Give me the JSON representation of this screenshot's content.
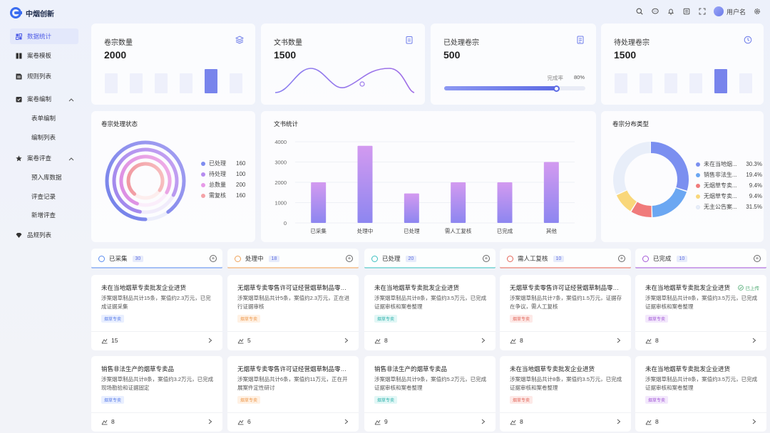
{
  "app": {
    "title": "中烟创新",
    "username": "用户名"
  },
  "topbar": {
    "icons": [
      "search-icon",
      "message-icon",
      "bell-icon",
      "document-icon",
      "fullscreen-icon",
      "user-avatar",
      "settings-icon"
    ]
  },
  "sidebar": {
    "items": [
      {
        "label": "数据统计",
        "icon": "dashboard-icon",
        "active": true
      },
      {
        "label": "案卷模板",
        "icon": "template-icon"
      },
      {
        "label": "规则列表",
        "icon": "rules-icon"
      },
      {
        "label": "案卷编制",
        "icon": "edit-icon",
        "expanded": true
      },
      {
        "label": "表单编制",
        "sub": true
      },
      {
        "label": "编制列表",
        "sub": true
      },
      {
        "label": "案卷评查",
        "icon": "star-icon",
        "expanded": true
      },
      {
        "label": "预入库数据",
        "sub": true
      },
      {
        "label": "评查记录",
        "sub": true
      },
      {
        "label": "新增评查",
        "sub": true
      },
      {
        "label": "品规列表",
        "icon": "gem-icon"
      }
    ]
  },
  "stats": [
    {
      "title": "卷宗数量",
      "value": "2000",
      "icon": "layers-icon"
    },
    {
      "title": "文书数量",
      "value": "1500",
      "icon": "clipboard-icon"
    },
    {
      "title": "已处理卷宗",
      "value": "500",
      "icon": "file-check-icon",
      "progress_label": "完成率",
      "progress_text": "80%",
      "progress": 0.8
    },
    {
      "title": "待处理卷宗",
      "value": "1500",
      "icon": "clock-icon"
    }
  ],
  "status_panel": {
    "title": "卷宗处理状态",
    "legend": [
      {
        "label": "已处理",
        "value": "160",
        "color": "#7f8cf0"
      },
      {
        "label": "待处理",
        "value": "100",
        "color": "#b68cf0"
      },
      {
        "label": "总数量",
        "value": "200",
        "color": "#e79ae8"
      },
      {
        "label": "需复核",
        "value": "160",
        "color": "#f4a3a8"
      }
    ]
  },
  "doc_chart": {
    "title": "文书统计",
    "chart_data": {
      "type": "bar",
      "categories": [
        "已采集",
        "处理中",
        "已处理",
        "需人工复核",
        "已完成",
        "其他"
      ],
      "values": [
        2000,
        3800,
        1450,
        2000,
        2000,
        3000
      ],
      "ylim": [
        0,
        4000
      ],
      "yticks": [
        "4000",
        "3000",
        "2000",
        "1000",
        "0"
      ],
      "xlabel": "",
      "ylabel": ""
    }
  },
  "dist_panel": {
    "title": "卷宗分布类型",
    "chart_data": {
      "type": "pie",
      "categories": [
        "未在当地烟...",
        "销售非法生...",
        "无烟草专卖...",
        "无烟草专卖...",
        "无主公告案..."
      ],
      "values": [
        30.3,
        19.4,
        9.4,
        9.4,
        31.5
      ],
      "labels": [
        "30.3%",
        "19.4%",
        "9.4%",
        "9.4%",
        "31.5%"
      ],
      "colors": [
        "#7b8ff0",
        "#6ba7f2",
        "#f07b7b",
        "#f9d77a",
        "#e8eef9"
      ]
    }
  },
  "columns": [
    {
      "label": "已采集",
      "count": "30",
      "color": "#5b8def"
    },
    {
      "label": "处理中",
      "count": "18",
      "color": "#f0a35a"
    },
    {
      "label": "已处理",
      "count": "20",
      "color": "#3cc0c0"
    },
    {
      "label": "需人工复核",
      "count": "10",
      "color": "#e5675a"
    },
    {
      "label": "已完成",
      "count": "10",
      "color": "#a55ad8"
    }
  ],
  "tasks": [
    [
      {
        "title": "未在当地烟草专卖批发企业进货",
        "desc": "涉案烟草制品共计15条，案值约2.3万元，已完成证据采集",
        "tag": "烟草专卖",
        "count": "15"
      },
      {
        "title": "销售非法生产的烟草专卖品",
        "desc": "涉案烟草制品共计8条，案值约3.2万元，已完成现场勘验和证据固定",
        "tag": "烟草专卖",
        "count": "8"
      }
    ],
    [
      {
        "title": "无烟草专卖零售许可证经营烟草制品零售...",
        "desc": "涉案烟草制品共计5条，案值约2.3万元，正在进行证据审核",
        "tag": "烟草专卖",
        "count": "5"
      },
      {
        "title": "无烟草专卖零售许可证经营烟草制品零售...",
        "desc": "涉案烟草制品共计6条，案值约11万元，正在开展案件定性研讨",
        "tag": "烟草专卖",
        "count": "6"
      }
    ],
    [
      {
        "title": "未在当地烟草专卖批发企业进货",
        "desc": "涉案烟草制品共计8条，案值约3.5万元，已完成证据审核和案卷整理",
        "tag": "烟草专卖",
        "count": "8"
      },
      {
        "title": "销售非法生产的烟草专卖品",
        "desc": "涉案烟草制品共计9条，案值约5.2万元，已完成证据审核和案卷整理",
        "tag": "烟草专卖",
        "count": "9"
      }
    ],
    [
      {
        "title": "无烟草专卖零售许可证经营烟草制品零售...",
        "desc": "涉案烟草制品共计7条，案值约1.5万元，证据存在争议，需人工复核",
        "tag": "烟草专卖",
        "count": "8"
      },
      {
        "title": "未在当地烟草专卖批发企业进货",
        "desc": "涉案烟草制品共计8条，案值约3.5万元，已完成证据审核和案卷整理",
        "tag": "烟草专卖",
        "count": "8"
      }
    ],
    [
      {
        "title": "未在当地烟草专卖批发企业进货",
        "desc": "涉案烟草制品共计8条，案值约3.5万元，已完成证据审核和案卷整理",
        "tag": "烟草专卖",
        "count": "8",
        "badge": "已上传"
      },
      {
        "title": "未在当地烟草专卖批发企业进货",
        "desc": "涉案烟草制品共计8条，案值约3.5万元，已完成证据审核和案卷整理",
        "tag": "烟草专卖",
        "count": "8"
      }
    ]
  ]
}
